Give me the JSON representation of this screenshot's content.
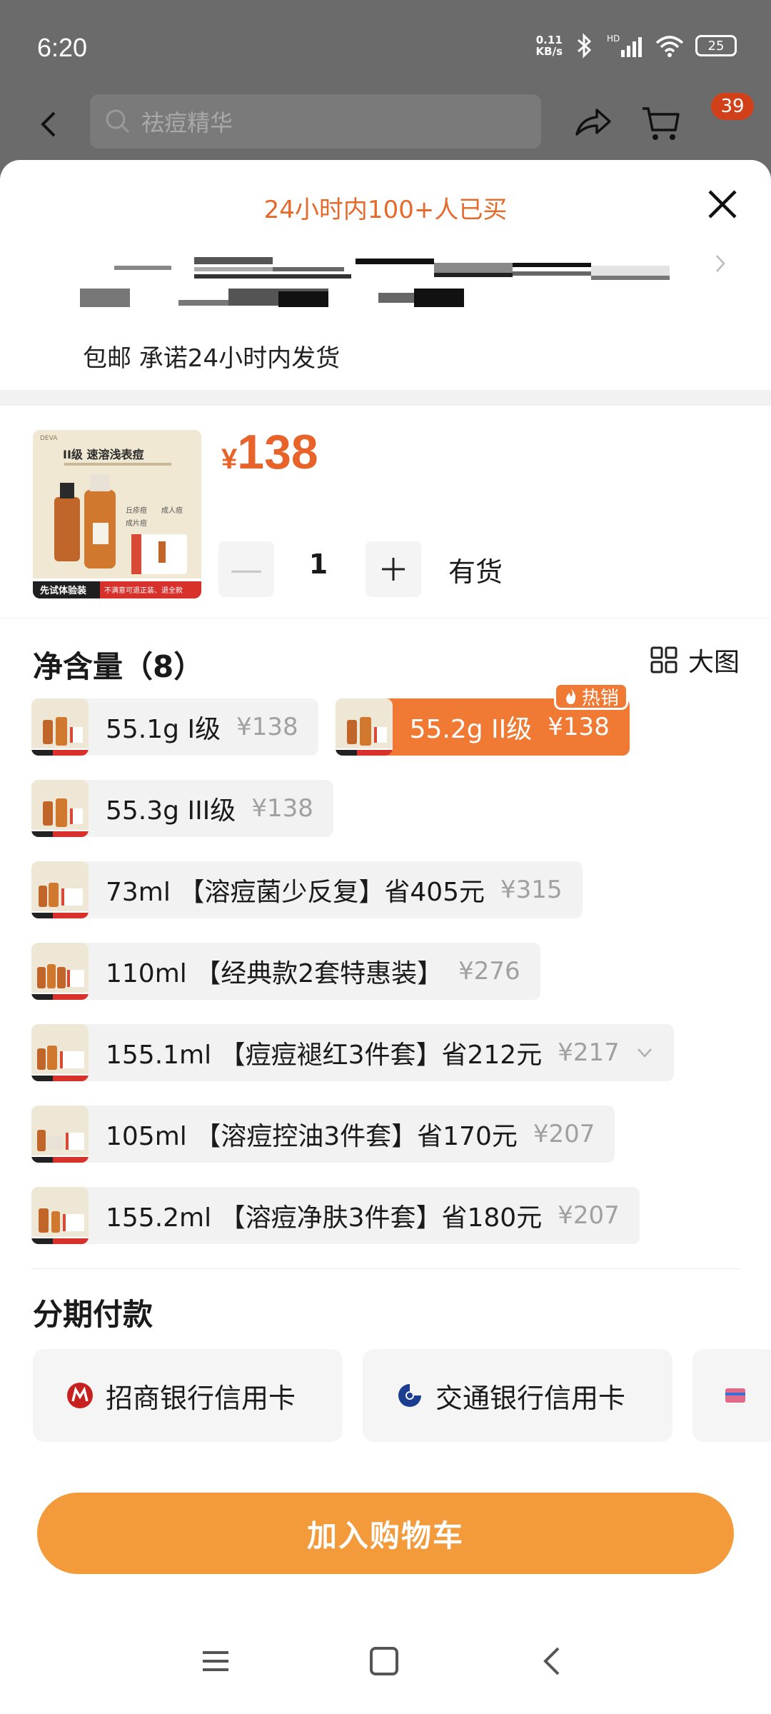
{
  "status_bar": {
    "time": "6:20",
    "net_speed": "0.11\nKB/s",
    "network": "HD",
    "battery": "25"
  },
  "top_bar": {
    "search_placeholder": "祛痘精华",
    "cart_count": "39"
  },
  "sheet": {
    "header_title": "24小时内100+人已买",
    "shipping": "包邮 承诺24小时内发货"
  },
  "product": {
    "currency": "¥",
    "price": "138",
    "quantity": "1",
    "stock": "有货",
    "thumb": {
      "brand": "DEVA",
      "headline": "II级 速溶浅表痘",
      "tags": [
        "丘疹痘",
        "成人痘",
        "成片痘"
      ],
      "footer_left": "先试体验装",
      "footer_right": "不满意可退正装、退全款"
    }
  },
  "spec": {
    "title": "净含量（8）",
    "big_image_label": "大图",
    "hot_badge": "热销",
    "options": [
      {
        "label": "55.1g I级",
        "price": "¥138",
        "selected": false
      },
      {
        "label": "55.2g II级",
        "price": "¥138",
        "selected": true
      },
      {
        "label": "55.3g III级",
        "price": "¥138",
        "selected": false
      },
      {
        "label": "73ml 【溶痘菌少反复】省405元",
        "price": "¥315",
        "selected": false
      },
      {
        "label": "110ml 【经典款2套特惠装】",
        "price": "¥276",
        "selected": false
      },
      {
        "label": "155.1ml 【痘痘褪红3件套】省212元",
        "price": "¥217",
        "selected": false
      },
      {
        "label": "105ml 【溶痘控油3件套】省170元",
        "price": "¥207",
        "selected": false
      },
      {
        "label": "155.2ml 【溶痘净肤3件套】省180元",
        "price": "¥207",
        "selected": false
      }
    ]
  },
  "installment": {
    "title": "分期付款",
    "banks": [
      "招商银行信用卡",
      "交通银行信用卡"
    ]
  },
  "cta": {
    "add_to_cart": "加入购物车"
  },
  "colors": {
    "accent": "#f07a34",
    "price": "#e8632a",
    "cta": "#f39a3b"
  }
}
